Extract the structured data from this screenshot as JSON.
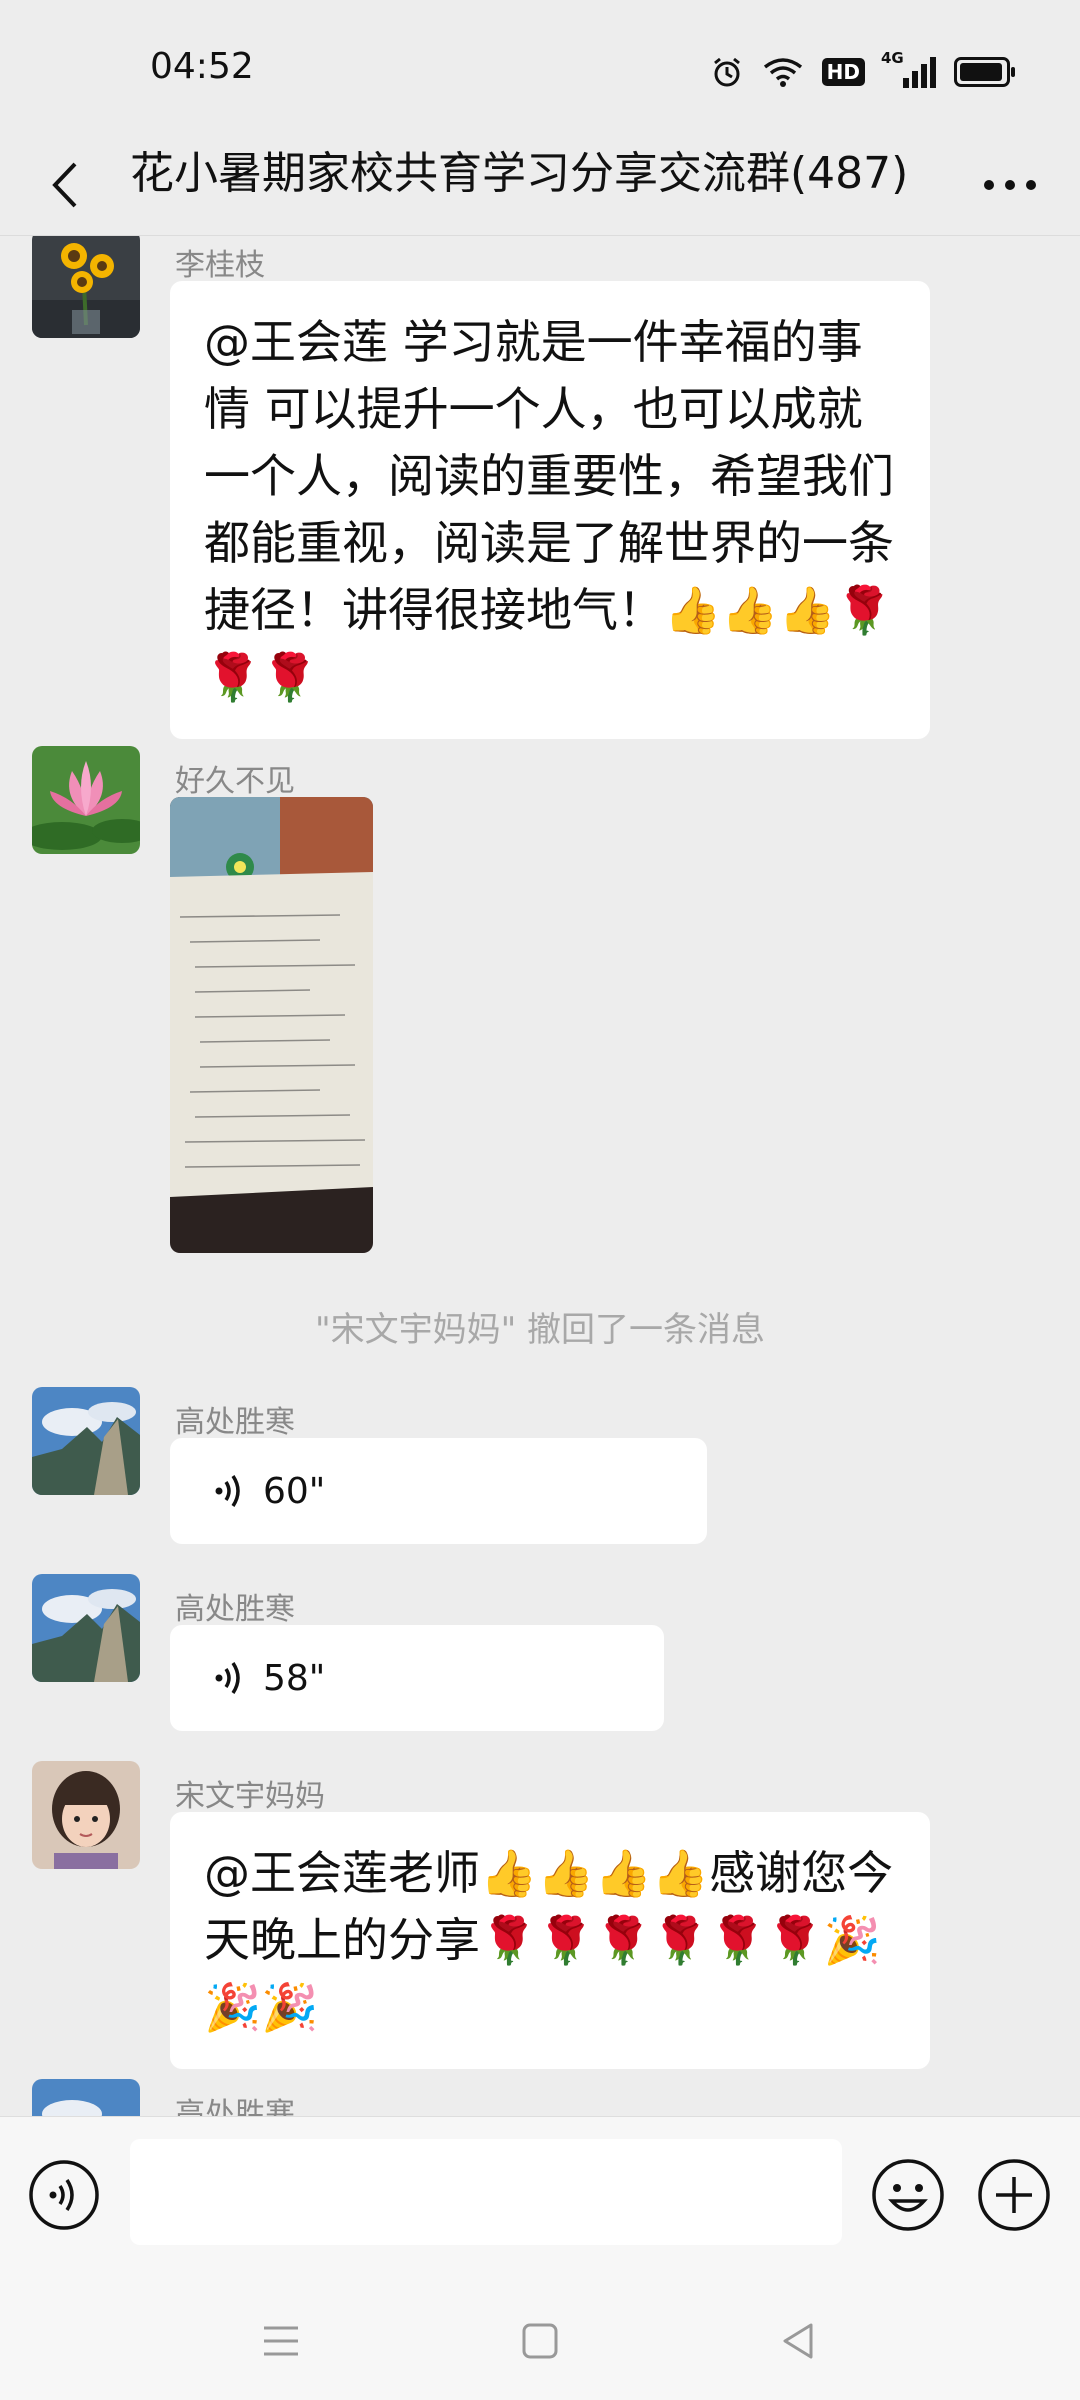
{
  "status_bar": {
    "time": "04:52",
    "network_label": "4G",
    "hd_label": "HD",
    "battery_level": 0.95
  },
  "header": {
    "title": "花小暑期家校共育学习分享交流群(487)",
    "back_icon": "chevron-left-icon",
    "more_icon": "more-dots-icon"
  },
  "messages": [
    {
      "type": "text",
      "sender": "李桂枝",
      "avatar": "sunflower-avatar",
      "text": "@王会莲  学习就是一件幸福的事情 可以提升一个人，也可以成就一个人，阅读的重要性，希望我们都能重视，阅读是了解世界的一条捷径！讲得很接地气！👍👍👍🌹🌹🌹"
    },
    {
      "type": "image",
      "sender": "好久不见",
      "avatar": "lotus-avatar",
      "image": "notebook-photo"
    },
    {
      "type": "system",
      "text": "\"宋文宇妈妈\" 撤回了一条消息"
    },
    {
      "type": "voice",
      "sender": "高处胜寒",
      "avatar": "mountain-avatar",
      "duration": "60\""
    },
    {
      "type": "voice",
      "sender": "高处胜寒",
      "avatar": "mountain-avatar",
      "duration": "58\""
    },
    {
      "type": "text",
      "sender": "宋文宇妈妈",
      "avatar": "child-avatar",
      "text": "@王会莲老师👍👍👍👍感谢您今天晚上的分享🌹🌹🌹🌹🌹🌹🎉🎉🎉"
    },
    {
      "type": "partial",
      "sender": "高处胜寒",
      "avatar": "mountain-avatar"
    }
  ],
  "input_bar": {
    "voice_icon": "voice-input-icon",
    "emoji_icon": "emoji-icon",
    "plus_icon": "plus-icon",
    "text_value": ""
  },
  "system_nav": {
    "menu_icon": "menu-icon",
    "home_icon": "home-icon",
    "back_icon": "back-triangle-icon"
  },
  "colors": {
    "background": "#ededed",
    "bubble": "#ffffff",
    "sender_name": "#888888",
    "system_text": "#a8a8a8"
  }
}
